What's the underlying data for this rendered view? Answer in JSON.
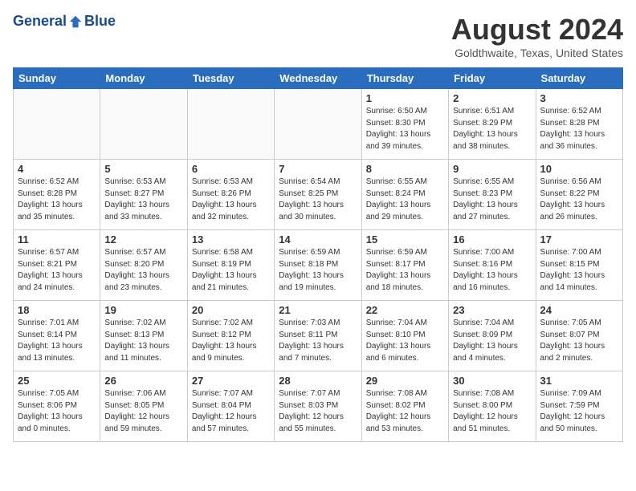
{
  "header": {
    "logo_general": "General",
    "logo_blue": "Blue",
    "title": "August 2024",
    "location": "Goldthwaite, Texas, United States"
  },
  "days_of_week": [
    "Sunday",
    "Monday",
    "Tuesday",
    "Wednesday",
    "Thursday",
    "Friday",
    "Saturday"
  ],
  "weeks": [
    [
      {
        "day": "",
        "info": ""
      },
      {
        "day": "",
        "info": ""
      },
      {
        "day": "",
        "info": ""
      },
      {
        "day": "",
        "info": ""
      },
      {
        "day": "1",
        "info": "Sunrise: 6:50 AM\nSunset: 8:30 PM\nDaylight: 13 hours\nand 39 minutes."
      },
      {
        "day": "2",
        "info": "Sunrise: 6:51 AM\nSunset: 8:29 PM\nDaylight: 13 hours\nand 38 minutes."
      },
      {
        "day": "3",
        "info": "Sunrise: 6:52 AM\nSunset: 8:28 PM\nDaylight: 13 hours\nand 36 minutes."
      }
    ],
    [
      {
        "day": "4",
        "info": "Sunrise: 6:52 AM\nSunset: 8:28 PM\nDaylight: 13 hours\nand 35 minutes."
      },
      {
        "day": "5",
        "info": "Sunrise: 6:53 AM\nSunset: 8:27 PM\nDaylight: 13 hours\nand 33 minutes."
      },
      {
        "day": "6",
        "info": "Sunrise: 6:53 AM\nSunset: 8:26 PM\nDaylight: 13 hours\nand 32 minutes."
      },
      {
        "day": "7",
        "info": "Sunrise: 6:54 AM\nSunset: 8:25 PM\nDaylight: 13 hours\nand 30 minutes."
      },
      {
        "day": "8",
        "info": "Sunrise: 6:55 AM\nSunset: 8:24 PM\nDaylight: 13 hours\nand 29 minutes."
      },
      {
        "day": "9",
        "info": "Sunrise: 6:55 AM\nSunset: 8:23 PM\nDaylight: 13 hours\nand 27 minutes."
      },
      {
        "day": "10",
        "info": "Sunrise: 6:56 AM\nSunset: 8:22 PM\nDaylight: 13 hours\nand 26 minutes."
      }
    ],
    [
      {
        "day": "11",
        "info": "Sunrise: 6:57 AM\nSunset: 8:21 PM\nDaylight: 13 hours\nand 24 minutes."
      },
      {
        "day": "12",
        "info": "Sunrise: 6:57 AM\nSunset: 8:20 PM\nDaylight: 13 hours\nand 23 minutes."
      },
      {
        "day": "13",
        "info": "Sunrise: 6:58 AM\nSunset: 8:19 PM\nDaylight: 13 hours\nand 21 minutes."
      },
      {
        "day": "14",
        "info": "Sunrise: 6:59 AM\nSunset: 8:18 PM\nDaylight: 13 hours\nand 19 minutes."
      },
      {
        "day": "15",
        "info": "Sunrise: 6:59 AM\nSunset: 8:17 PM\nDaylight: 13 hours\nand 18 minutes."
      },
      {
        "day": "16",
        "info": "Sunrise: 7:00 AM\nSunset: 8:16 PM\nDaylight: 13 hours\nand 16 minutes."
      },
      {
        "day": "17",
        "info": "Sunrise: 7:00 AM\nSunset: 8:15 PM\nDaylight: 13 hours\nand 14 minutes."
      }
    ],
    [
      {
        "day": "18",
        "info": "Sunrise: 7:01 AM\nSunset: 8:14 PM\nDaylight: 13 hours\nand 13 minutes."
      },
      {
        "day": "19",
        "info": "Sunrise: 7:02 AM\nSunset: 8:13 PM\nDaylight: 13 hours\nand 11 minutes."
      },
      {
        "day": "20",
        "info": "Sunrise: 7:02 AM\nSunset: 8:12 PM\nDaylight: 13 hours\nand 9 minutes."
      },
      {
        "day": "21",
        "info": "Sunrise: 7:03 AM\nSunset: 8:11 PM\nDaylight: 13 hours\nand 7 minutes."
      },
      {
        "day": "22",
        "info": "Sunrise: 7:04 AM\nSunset: 8:10 PM\nDaylight: 13 hours\nand 6 minutes."
      },
      {
        "day": "23",
        "info": "Sunrise: 7:04 AM\nSunset: 8:09 PM\nDaylight: 13 hours\nand 4 minutes."
      },
      {
        "day": "24",
        "info": "Sunrise: 7:05 AM\nSunset: 8:07 PM\nDaylight: 13 hours\nand 2 minutes."
      }
    ],
    [
      {
        "day": "25",
        "info": "Sunrise: 7:05 AM\nSunset: 8:06 PM\nDaylight: 13 hours\nand 0 minutes."
      },
      {
        "day": "26",
        "info": "Sunrise: 7:06 AM\nSunset: 8:05 PM\nDaylight: 12 hours\nand 59 minutes."
      },
      {
        "day": "27",
        "info": "Sunrise: 7:07 AM\nSunset: 8:04 PM\nDaylight: 12 hours\nand 57 minutes."
      },
      {
        "day": "28",
        "info": "Sunrise: 7:07 AM\nSunset: 8:03 PM\nDaylight: 12 hours\nand 55 minutes."
      },
      {
        "day": "29",
        "info": "Sunrise: 7:08 AM\nSunset: 8:02 PM\nDaylight: 12 hours\nand 53 minutes."
      },
      {
        "day": "30",
        "info": "Sunrise: 7:08 AM\nSunset: 8:00 PM\nDaylight: 12 hours\nand 51 minutes."
      },
      {
        "day": "31",
        "info": "Sunrise: 7:09 AM\nSunset: 7:59 PM\nDaylight: 12 hours\nand 50 minutes."
      }
    ]
  ]
}
